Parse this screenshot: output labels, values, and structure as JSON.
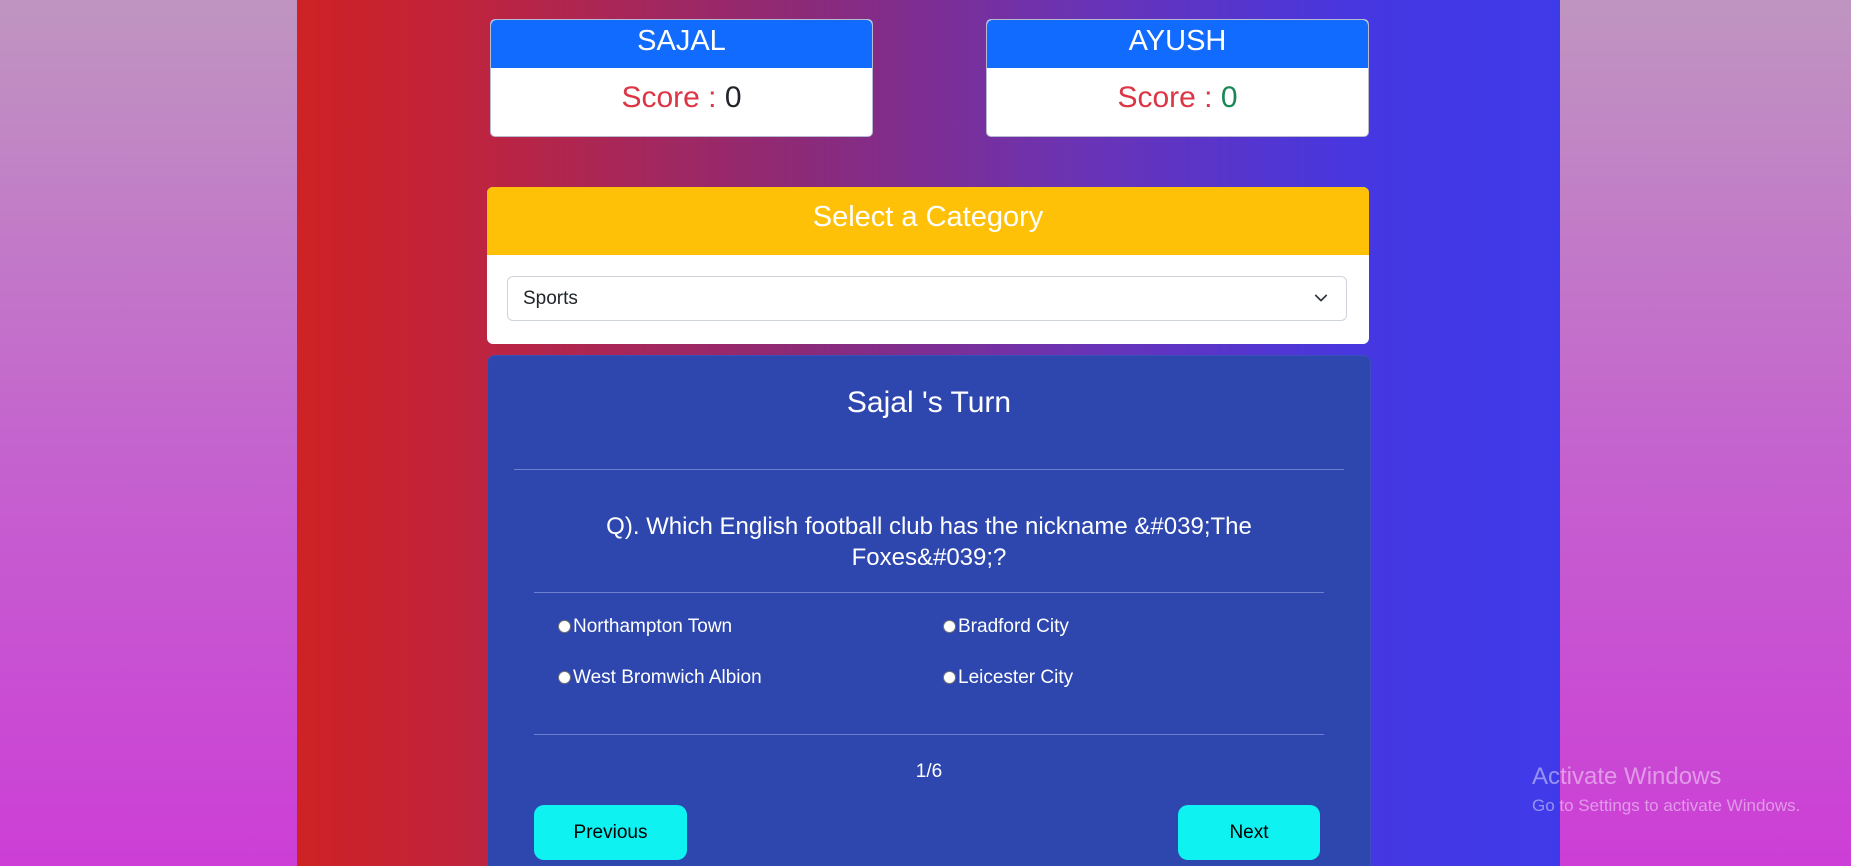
{
  "players": [
    {
      "name": "SAJAL",
      "score_label": "Score :",
      "score": "0"
    },
    {
      "name": "AYUSH",
      "score_label": "Score :",
      "score": "0"
    }
  ],
  "category": {
    "title": "Select a Category",
    "selected": "Sports"
  },
  "quiz": {
    "turn_title": "Sajal 's Turn",
    "question": "Q). Which English football club has the nickname &#039;The Foxes&#039;?",
    "options": [
      "Northampton Town",
      "Bradford City",
      "West Bromwich Albion",
      "Leicester City"
    ],
    "progress": "1/6",
    "previous_label": "Previous",
    "next_label": "Next"
  },
  "watermark": {
    "title": "Activate Windows",
    "subtitle": "Go to Settings to activate Windows."
  },
  "colors": {
    "player_header": "#126bff",
    "category_header": "#ffc107",
    "quiz_card": "#2e47af",
    "button": "#0ff2f2",
    "score_label": "#dc3545",
    "score_positive": "#198754"
  }
}
